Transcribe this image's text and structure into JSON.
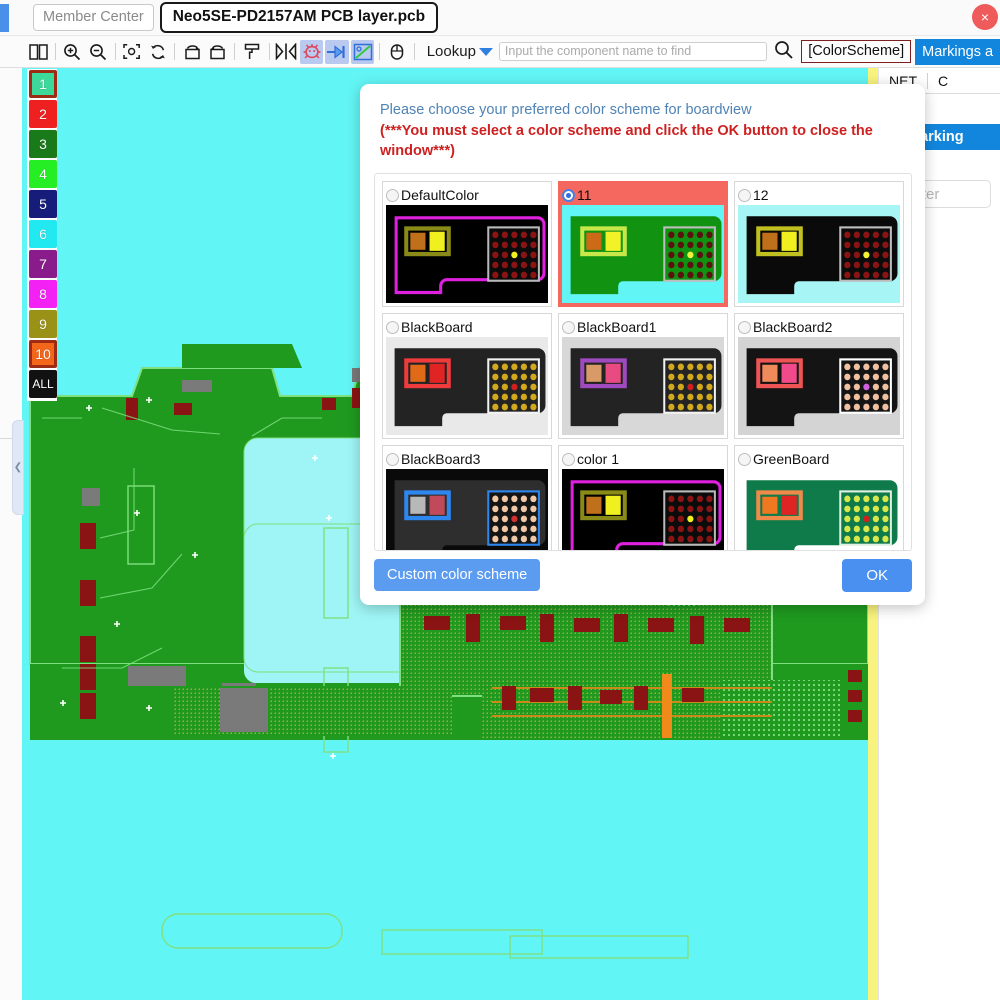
{
  "topbar": {
    "member_tab": "Member Center",
    "file_tab": "Neo5SE-PD2157AM PCB layer.pcb",
    "close_label": "×"
  },
  "toolbar": {
    "icons": [
      {
        "name": "split-view-icon",
        "label": "split-view"
      },
      {
        "name": "zoom-in-icon",
        "label": "zoom-in"
      },
      {
        "name": "zoom-out-icon",
        "label": "zoom-out"
      },
      {
        "name": "fit-to-screen-icon",
        "label": "fit-to-screen"
      },
      {
        "name": "refresh-icon",
        "label": "refresh"
      },
      {
        "name": "rotate-left-icon",
        "label": "rotate-left"
      },
      {
        "name": "rotate-right-icon",
        "label": "rotate-right"
      },
      {
        "name": "paint-roller-icon",
        "label": "paint-roller"
      },
      {
        "name": "mirror-flip-icon",
        "label": "mirror-flip"
      },
      {
        "name": "bug-icon",
        "label": "bug"
      },
      {
        "name": "play-marker-icon",
        "label": "play-marker"
      },
      {
        "name": "measure-icon",
        "label": "measure"
      },
      {
        "name": "mouse-icon",
        "label": "mouse"
      }
    ],
    "lookup_label": "Lookup",
    "search_placeholder": "Input the component name to find",
    "search_value": "",
    "colorscheme_button": "[ColorScheme]",
    "markings_button": "Markings a"
  },
  "layers": {
    "items": [
      {
        "label": "1",
        "color": "#3dd99a",
        "selected": true
      },
      {
        "label": "2",
        "color": "#ee2020",
        "selected": false
      },
      {
        "label": "3",
        "color": "#197a19",
        "selected": false
      },
      {
        "label": "4",
        "color": "#25ee25",
        "selected": false
      },
      {
        "label": "5",
        "color": "#161c7a",
        "selected": false
      },
      {
        "label": "6",
        "color": "#22e8f0",
        "selected": false
      },
      {
        "label": "7",
        "color": "#8a1b8a",
        "selected": false
      },
      {
        "label": "8",
        "color": "#f421f4",
        "selected": false
      },
      {
        "label": "9",
        "color": "#9a9216",
        "selected": false
      },
      {
        "label": "10",
        "color": "#f4671a",
        "selected": true
      },
      {
        "label": "ALL",
        "color": "#111111",
        "selected": false
      }
    ]
  },
  "right_panel": {
    "tabs": [
      {
        "label": "NET"
      },
      {
        "label": "C"
      }
    ],
    "my_markings": "My marking",
    "filter_placeholder": "Filter"
  },
  "dialog": {
    "title": "Please choose your preferred color scheme for boardview",
    "warning": "(***You must select a color scheme and click the OK button to close the window***)",
    "custom_button": "Custom color scheme",
    "ok_button": "OK",
    "schemes": [
      {
        "label": "DefaultColor",
        "selected": false,
        "bg": "#000000",
        "board": "#000000",
        "outline": "#e020e0",
        "chipA": "#8a8a18",
        "chipAinner": "#c0701a",
        "chipAled": "#f0f020",
        "gridBorder": "#b9b9b9",
        "gridBg": "#0b0b0b",
        "dot": "#8a1414",
        "dotCenter": "#f0f020"
      },
      {
        "label": "11",
        "selected": true,
        "bg": "#62f5f5",
        "board": "#119211",
        "outline": "#119211",
        "chipA": "#c8e84a",
        "chipAinner": "#cc6a18",
        "chipAled": "#f2f228",
        "gridBorder": "#bdbdbd",
        "gridBg": "#119211",
        "dot": "#5c1010",
        "dotCenter": "#f0f040"
      },
      {
        "label": "12",
        "selected": false,
        "bg": "#a8f5f5",
        "board": "#0a0a0a",
        "outline": "#0a0a0a",
        "chipA": "#c0c020",
        "chipAinner": "#c0701a",
        "chipAled": "#f0f020",
        "gridBorder": "#bdbdbd",
        "gridBg": "#0b0b0b",
        "dot": "#8a1414",
        "dotCenter": "#f2f230"
      },
      {
        "label": "BlackBoard",
        "selected": false,
        "bg": "#e9e9e9",
        "board": "#232323",
        "outline": "#232323",
        "chipA": "#ef3b3b",
        "chipAinner": "#e06a18",
        "chipAled": "#e02424",
        "gridBorder": "#f2f2f2",
        "gridBg": "#232323",
        "dot": "#d2a81c",
        "dotCenter": "#d02020"
      },
      {
        "label": "BlackBoard1",
        "selected": false,
        "bg": "#d8d8d8",
        "board": "#232323",
        "outline": "#232323",
        "chipA": "#a04ac0",
        "chipAinner": "#d89a66",
        "chipAled": "#e84a82",
        "gridBorder": "#f2f2f2",
        "gridBg": "#232323",
        "dot": "#d2a81c",
        "dotCenter": "#d02020"
      },
      {
        "label": "BlackBoard2",
        "selected": false,
        "bg": "#d4d4d4",
        "board": "#141414",
        "outline": "#141414",
        "chipA": "#ef5454",
        "chipAinner": "#ef8a5a",
        "chipAled": "#f04a8a",
        "gridBorder": "#ffffff",
        "gridBg": "#141414",
        "dot": "#f0c0a0",
        "dotCenter": "#d060e0"
      },
      {
        "label": "BlackBoard3",
        "selected": false,
        "bg": "#0a0a0a",
        "board": "#2e2e2e",
        "outline": "#2e2e2e",
        "chipA": "#2e86ef",
        "chipAinner": "#b8b8b8",
        "chipAled": "#c04a5a",
        "gridBorder": "#2e86ef",
        "gridBg": "#141414",
        "dot": "#f0c8a8",
        "dotCenter": "#d03030"
      },
      {
        "label": "color 1",
        "selected": false,
        "bg": "#000000",
        "board": "#000000",
        "outline": "#e020e0",
        "chipA": "#8a8a18",
        "chipAinner": "#c0701a",
        "chipAled": "#f0f020",
        "gridBorder": "#b9b9b9",
        "gridBg": "#0b0b0b",
        "dot": "#8a1414",
        "dotCenter": "#f0f020"
      },
      {
        "label": "GreenBoard",
        "selected": false,
        "bg": "#ffffff",
        "board": "#0f7a4a",
        "outline": "#0f7a4a",
        "chipA": "#f08a4a",
        "chipAinner": "#f07820",
        "chipAled": "#e02424",
        "gridBorder": "#dff0e0",
        "gridBg": "#0f7a4a",
        "dot": "#d8e84a",
        "dotCenter": "#d02020"
      }
    ]
  },
  "canvas": {
    "background_color": "#62f5f5",
    "board_color": "#1f9a1f",
    "trace_color": "#7fe07f",
    "pad_color": "#8a1414",
    "cutout_color": "#9ff5f5"
  }
}
